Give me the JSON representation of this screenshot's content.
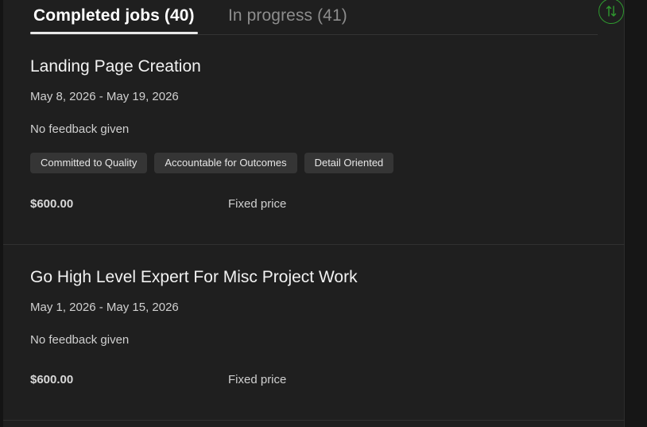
{
  "tabs": {
    "completed_label": "Completed jobs (40)",
    "in_progress_label": "In progress (41)"
  },
  "sort_icon": "sort-arrows-icon",
  "accent_color": "#2f9a2f",
  "jobs": [
    {
      "title": "Landing Page Creation",
      "dates": "May 8, 2026 - May 19, 2026",
      "feedback": "No feedback given",
      "tags": [
        "Committed to Quality",
        "Accountable for Outcomes",
        "Detail Oriented"
      ],
      "price": "$600.00",
      "price_type": "Fixed price"
    },
    {
      "title": "Go High Level Expert For Misc Project Work",
      "dates": "May 1, 2026 - May 15, 2026",
      "feedback": "No feedback given",
      "tags": [],
      "price": "$600.00",
      "price_type": "Fixed price"
    }
  ]
}
